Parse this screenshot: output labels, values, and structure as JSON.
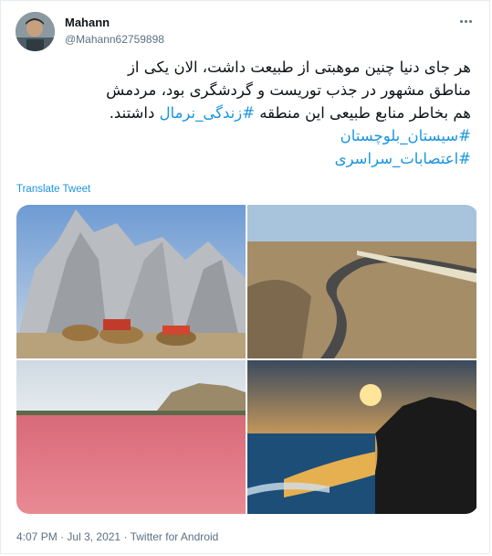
{
  "tweet": {
    "author_name": "Mahann",
    "author_handle": "@Mahann62759898",
    "text_line1": "هر جای دنیا چنین موهبتی از طبیعت داشت، الان یکی از",
    "text_line2": "مناطق مشهور در جذب توریست و گردشگری بود، مردمش",
    "text_line3_a": "هم بخاطر منابع طبیعی این منطقه",
    "hashtag1": "#زندگی_نرمال",
    "text_line3_b": "داشتند.",
    "hashtag2": "#سیستان_بلوچستان",
    "hashtag3": "#اعتصابات_سراسری",
    "translate_label": "Translate Tweet",
    "time": "4:07 PM",
    "date": "Jul 3, 2021",
    "source": "Twitter for Android",
    "separator": "·"
  },
  "colors": {
    "link": "#1b95e0",
    "muted": "#5b7083",
    "text": "#0f1419"
  },
  "icons": {
    "more": "more-horizontal-icon"
  }
}
